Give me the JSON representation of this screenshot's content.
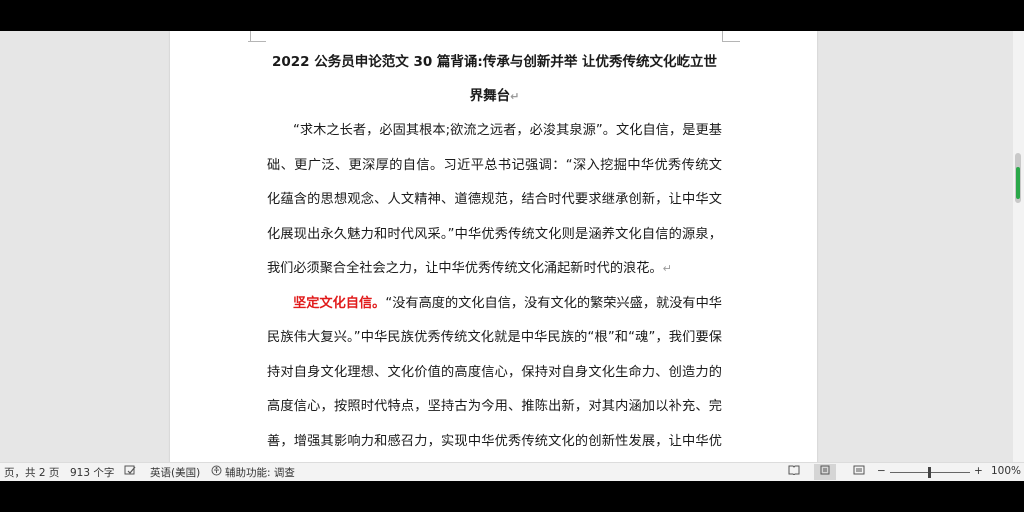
{
  "document": {
    "title_line1": "2022 公务员申论范文 30 篇背诵:传承与创新并举  让优秀传统文化屹立世",
    "title_line2": "界舞台",
    "paragraph1": "“求木之长者，必固其根本;欲流之远者，必浚其泉源”。文化自信，是更基础、更广泛、更深厚的自信。习近平总书记强调：“深入挖掘中华优秀传统文化蕴含的思想观念、人文精神、道德规范，结合时代要求继承创新，让中华文化展现出永久魅力和时代风采。”中华优秀传统文化则是涵养文化自信的源泉，我们必须聚合全社会之力，让中华优秀传统文化涌起新时代的浪花。",
    "paragraph2_heading": "坚定文化自信。",
    "paragraph2": "“没有高度的文化自信，没有文化的繁荣兴盛，就没有中华民族伟大复兴。”中华民族优秀传统文化就是中华民族的“根”和“魂”，我们要保持对自身文化理想、文化价值的高度信心，保持对自身文化生命力、创造力的高度信心，按照时代特点，坚持古为今用、推陈出新，对其内涵加以补充、完善，增强其影响力和感召力，实现中华优秀传统文化的创新性发展，让中华优秀传统",
    "paragraph_mark": "↵"
  },
  "statusbar": {
    "page_info": "页，共 2 页",
    "word_count": "913 个字",
    "language": "英语(美国)",
    "accessibility": "辅助功能: 调查",
    "zoom_minus": "−",
    "zoom_plus": "+",
    "zoom_level": "100%"
  },
  "colors": {
    "accent_red": "#e11b1b",
    "scroll_accent": "#2ba84a"
  },
  "icons": {
    "proofing": "proofing-icon",
    "accessibility": "accessibility-icon",
    "read_mode": "read-mode-icon",
    "print_layout": "print-layout-icon",
    "web_layout": "web-layout-icon"
  }
}
